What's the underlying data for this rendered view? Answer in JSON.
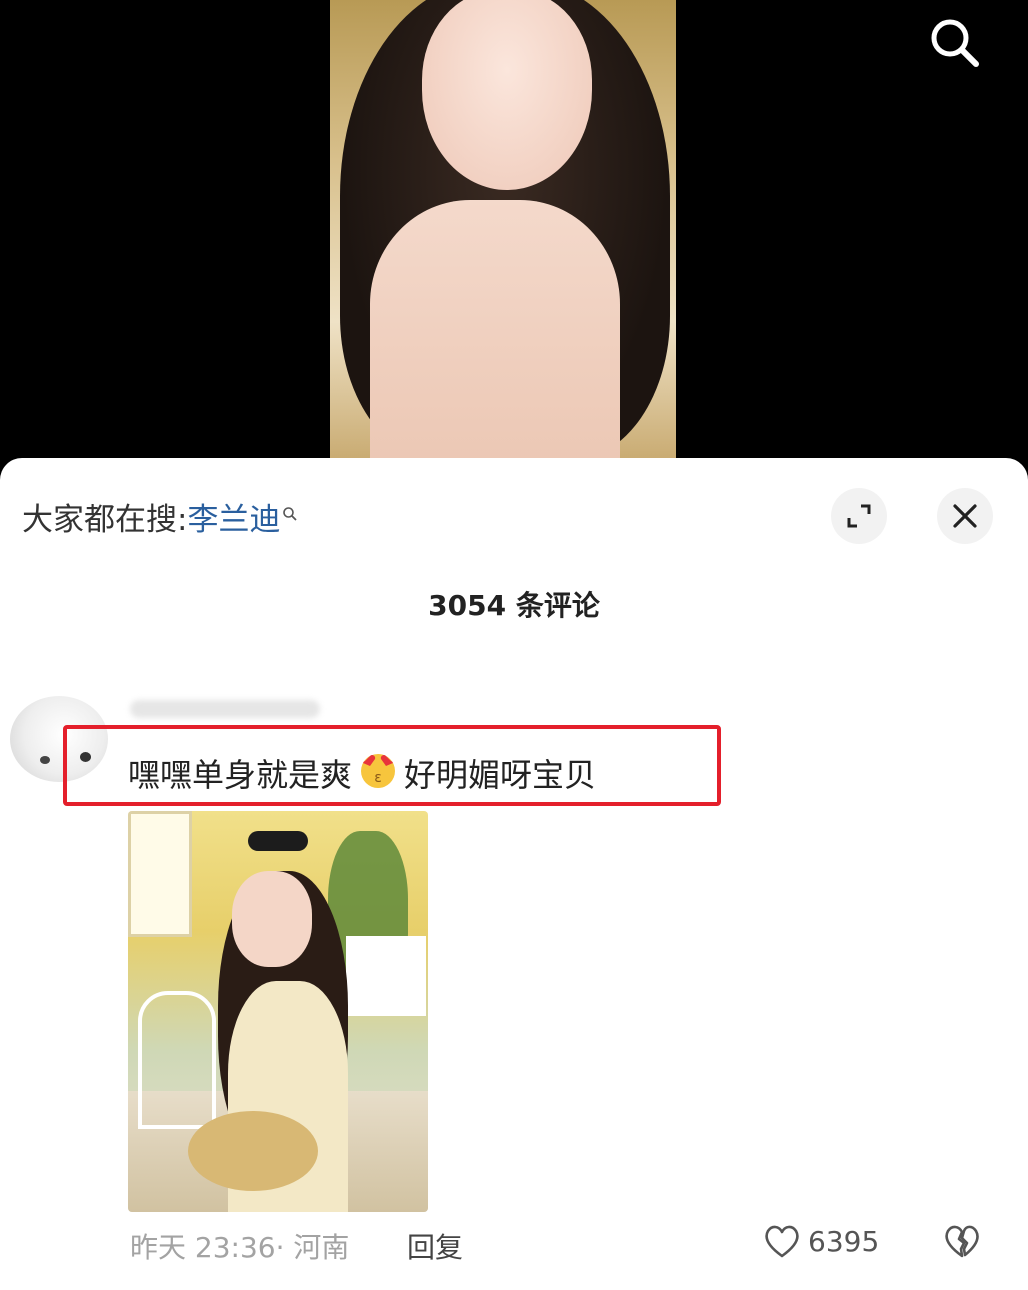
{
  "video": {
    "search_icon": "search-icon"
  },
  "sheet": {
    "suggest_prefix": "大家都在搜:",
    "suggest_keyword": "李兰迪",
    "expand_icon": "expand-icon",
    "close_icon": "close-icon",
    "comment_count": "3054 条评论"
  },
  "comment": {
    "text_before": "嘿嘿单身就是爽",
    "emoji": "heart-eyes-kiss-emoji",
    "text_after": "好明媚呀宝贝",
    "time": "昨天 23:36",
    "location": "· 河南",
    "reply_label": "回复",
    "likes": "6395",
    "highlight_color": "#e41f2b"
  }
}
